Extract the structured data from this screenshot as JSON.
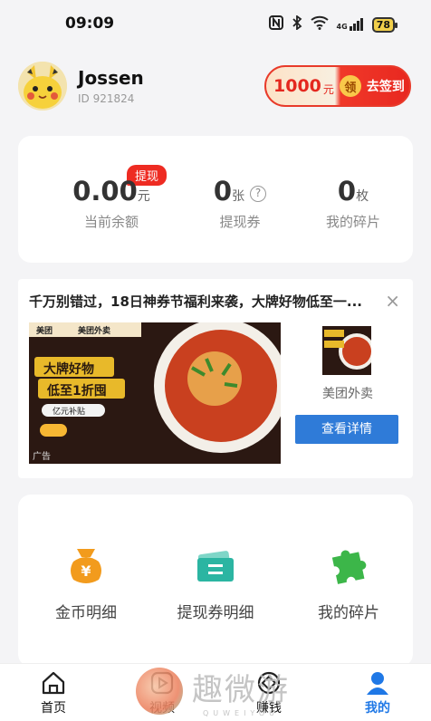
{
  "status_bar": {
    "time": "09:09",
    "network": "4G",
    "battery": "78"
  },
  "profile": {
    "name": "Jossen",
    "id": "ID  921824"
  },
  "checkin": {
    "amount": "1000",
    "unit": "元",
    "badge": "领",
    "action": "去签到"
  },
  "stats": {
    "badge": "提现",
    "items": [
      {
        "value": "0.00",
        "unit": "元",
        "label": "当前余额"
      },
      {
        "value": "0",
        "unit": "张",
        "label": "提现券",
        "help": "?"
      },
      {
        "value": "0",
        "unit": "枚",
        "label": "我的碎片"
      }
    ]
  },
  "ad": {
    "title": "千万别错过，18日神券节福利来袭，大牌好物低至一...",
    "close": "×",
    "banner": {
      "brand1": "美团",
      "brand2": "美团外卖",
      "headline": "大牌好物",
      "sub": "低至1折囤",
      "subsidy": "亿元补贴",
      "tag": "广告"
    },
    "brand": "美团外卖",
    "detail_button": "查看详情"
  },
  "tools": [
    {
      "icon": "coin-bag-icon",
      "label": "金币明细"
    },
    {
      "icon": "voucher-ticket-icon",
      "label": "提现券明细"
    },
    {
      "icon": "puzzle-piece-icon",
      "label": "我的碎片"
    }
  ],
  "nav": [
    {
      "icon": "home-icon",
      "label": "首页"
    },
    {
      "icon": "video-icon",
      "label": "视频"
    },
    {
      "icon": "treasure-icon",
      "label": "赚钱"
    },
    {
      "icon": "profile-icon",
      "label": "我的"
    }
  ],
  "watermark": {
    "cn": "趣微游",
    "en": "QUWEIYOU"
  },
  "colors": {
    "accent_red": "#ee2b22",
    "active_blue": "#1f78e6",
    "tool_orange": "#f29b1d",
    "tool_teal": "#2bb5a2",
    "tool_green": "#3cb649"
  }
}
